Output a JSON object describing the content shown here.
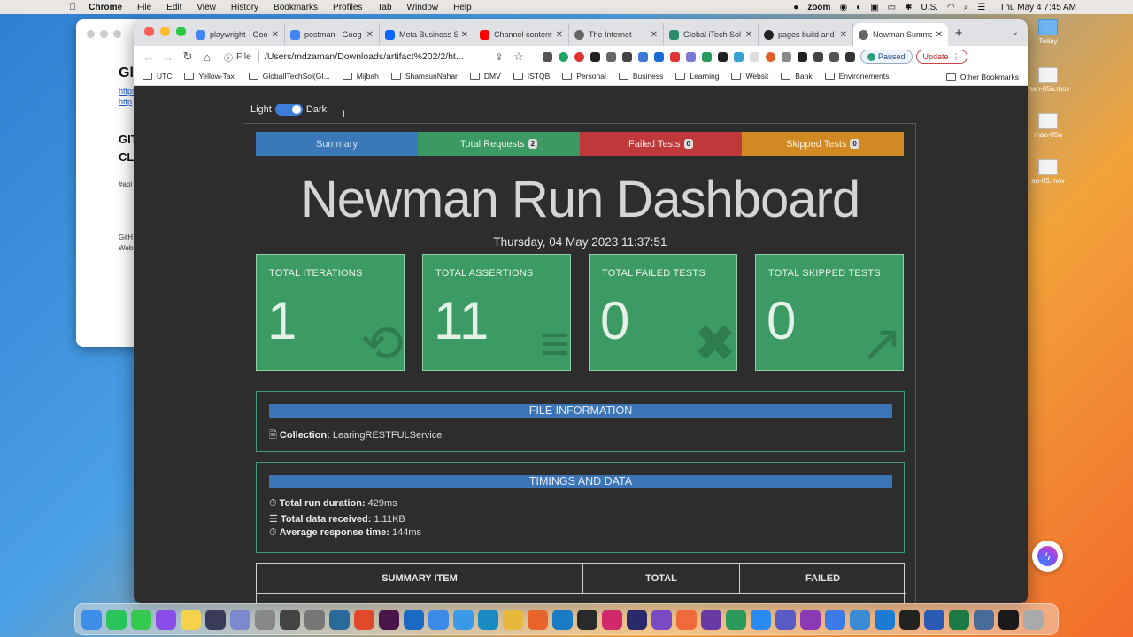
{
  "menubar": {
    "app": "Chrome",
    "items": [
      "File",
      "Edit",
      "View",
      "History",
      "Bookmarks",
      "Profiles",
      "Tab",
      "Window",
      "Help"
    ],
    "zoom": "zoom",
    "input_source": "U.S.",
    "clock": "Thu May 4  7:45 AM"
  },
  "desktop": {
    "files": [
      "Today",
      "man-05a.mov",
      "man-05a",
      "an-05.mov"
    ]
  },
  "bg_window": {
    "lines": [
      "Gl",
      "https",
      "http",
      "GIT",
      "CL",
      "#api",
      "GitH",
      "Web"
    ]
  },
  "browser": {
    "tabs": [
      {
        "label": "playwright - Goo",
        "color": "#4285f4"
      },
      {
        "label": "postman - Goog",
        "color": "#4285f4"
      },
      {
        "label": "Meta Business S",
        "color": "#0866ff"
      },
      {
        "label": "Channel content",
        "color": "#ff0000"
      },
      {
        "label": "The Internet",
        "color": "#666666"
      },
      {
        "label": "Global iTech Sol",
        "color": "#2a8a6a"
      },
      {
        "label": "pages build and",
        "color": "#222222"
      },
      {
        "label": "Newman Summa",
        "color": "#666666"
      }
    ],
    "new_tab": "+",
    "address_scheme": "File",
    "address": "/Users/mdzaman/Downloads/artifact%202/2/ht...",
    "paused": "Paused",
    "update": "Update",
    "bookmarks": [
      "UTC",
      "Yellow-Taxi",
      "GlobalITechSol(GI...",
      "Mijbah",
      "ShamsunNahar",
      "DMV",
      "ISTQB",
      "Personal",
      "Business",
      "Learning",
      "Websit",
      "Bank",
      "Environements"
    ],
    "other_bookmarks": "Other Bookmarks"
  },
  "page": {
    "theme_light": "Light",
    "theme_dark": "Dark",
    "pills": [
      {
        "label": "Summary",
        "count": "",
        "color": "#3a78b8"
      },
      {
        "label": "Total Requests",
        "count": "2",
        "color": "#3a9a62"
      },
      {
        "label": "Failed Tests",
        "count": "0",
        "color": "#c0393a"
      },
      {
        "label": "Skipped Tests",
        "count": "0",
        "color": "#d18a22"
      }
    ],
    "title": "Newman Run Dashboard",
    "date": "Thursday, 04 May 2023 11:37:51",
    "stats": [
      {
        "label": "TOTAL ITERATIONS",
        "value": "1",
        "icon": "⟲"
      },
      {
        "label": "TOTAL ASSERTIONS",
        "value": "11",
        "icon": "≡"
      },
      {
        "label": "TOTAL FAILED TESTS",
        "value": "0",
        "icon": "✖"
      },
      {
        "label": "TOTAL SKIPPED TESTS",
        "value": "0",
        "icon": "↗"
      }
    ],
    "file_info": {
      "header": "FILE INFORMATION",
      "collection_label": "Collection:",
      "collection_value": "LearingRESTFULService"
    },
    "timings": {
      "header": "TIMINGS AND DATA",
      "rows": [
        {
          "icon": "⏱",
          "label": "Total run duration:",
          "value": "429ms"
        },
        {
          "icon": "☰",
          "label": "Total data received:",
          "value": "1.11KB"
        },
        {
          "icon": "⏱",
          "label": "Average response time:",
          "value": "144ms"
        }
      ]
    },
    "summary_table": {
      "headers": [
        "SUMMARY ITEM",
        "TOTAL",
        "FAILED"
      ]
    }
  },
  "dock": {
    "apps": [
      {
        "name": "finder",
        "color": "#3c8ee8"
      },
      {
        "name": "whatsapp",
        "color": "#29c45b"
      },
      {
        "name": "messages",
        "color": "#35c94f"
      },
      {
        "name": "messenger",
        "color": "#8a4de8"
      },
      {
        "name": "notes",
        "color": "#f4d34a"
      },
      {
        "name": "siri",
        "color": "#3a3a5a"
      },
      {
        "name": "launchpad",
        "color": "#7a8acc"
      },
      {
        "name": "contacts",
        "color": "#888888"
      },
      {
        "name": "finalcut",
        "color": "#444444"
      },
      {
        "name": "settings",
        "color": "#777777"
      },
      {
        "name": "quicktime",
        "color": "#2a6a9a"
      },
      {
        "name": "office",
        "color": "#e04a2a"
      },
      {
        "name": "slack",
        "color": "#4a154b"
      },
      {
        "name": "outlook",
        "color": "#1a6ac4"
      },
      {
        "name": "mail",
        "color": "#3a8ae8"
      },
      {
        "name": "safari",
        "color": "#3a9ae8"
      },
      {
        "name": "edge",
        "color": "#1a8ac4"
      },
      {
        "name": "chrome",
        "color": "#e8b83a"
      },
      {
        "name": "firefox",
        "color": "#e8642a"
      },
      {
        "name": "vscode",
        "color": "#1a7ac4"
      },
      {
        "name": "pycharm",
        "color": "#2a2a2a"
      },
      {
        "name": "intellij",
        "color": "#d02a6a"
      },
      {
        "name": "eclipse",
        "color": "#2a2a6a"
      },
      {
        "name": "vs",
        "color": "#7a4ac4"
      },
      {
        "name": "postman",
        "color": "#ef6a3a"
      },
      {
        "name": "media",
        "color": "#6a3aa4"
      },
      {
        "name": "xcode",
        "color": "#2a9a5a"
      },
      {
        "name": "zoom",
        "color": "#2a8af4"
      },
      {
        "name": "teams",
        "color": "#5a5ac4"
      },
      {
        "name": "onenote",
        "color": "#8a3ab4"
      },
      {
        "name": "xcode2",
        "color": "#3a7ae8"
      },
      {
        "name": "tool",
        "color": "#3a8ad4"
      },
      {
        "name": "r",
        "color": "#1a7ad4"
      },
      {
        "name": "terminal",
        "color": "#222222"
      },
      {
        "name": "word",
        "color": "#2a5ab4"
      },
      {
        "name": "excel",
        "color": "#1e7a44"
      },
      {
        "name": "screen",
        "color": "#4a6a9a"
      },
      {
        "name": "terminal2",
        "color": "#1a1a1a"
      },
      {
        "name": "trash",
        "color": "#aaaaaa"
      }
    ]
  }
}
